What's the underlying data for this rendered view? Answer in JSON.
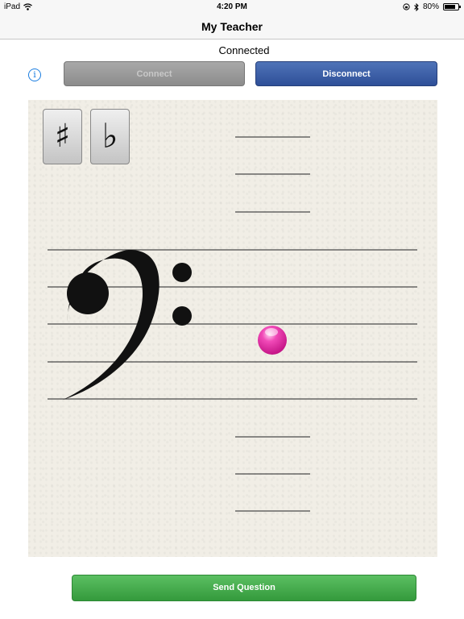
{
  "status_bar": {
    "device": "iPad",
    "time": "4:20 PM",
    "battery": "80%",
    "battery_level": 0.8
  },
  "nav": {
    "title": "My Teacher"
  },
  "connection": {
    "status": "Connected",
    "connect_label": "Connect",
    "disconnect_label": "Disconnect"
  },
  "staff": {
    "clef": "bass",
    "sharp_label": "♯",
    "flat_label": "♭"
  },
  "actions": {
    "send_label": "Send Question"
  },
  "colors": {
    "note": "#e0269f",
    "disconnect": "#2e4f98",
    "send": "#3aa444",
    "info": "#1a7de0"
  }
}
